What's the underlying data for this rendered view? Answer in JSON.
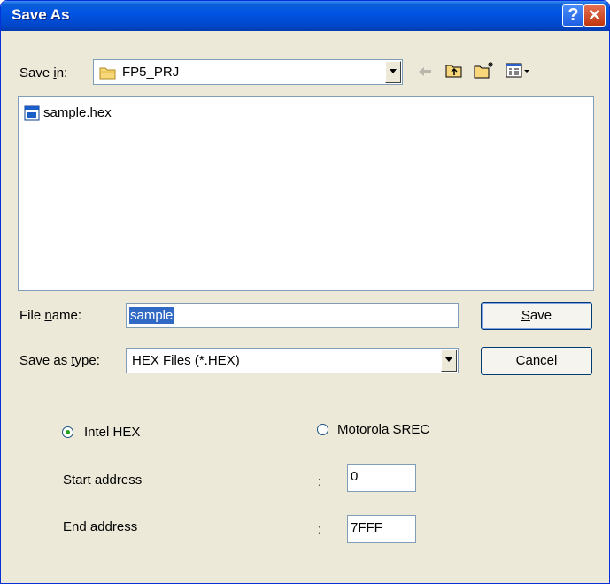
{
  "window": {
    "title": "Save As"
  },
  "title_buttons": {
    "help": "?",
    "close": "✕"
  },
  "toolbar": {
    "save_in_label_pre": "Save ",
    "save_in_label_accel": "i",
    "save_in_label_post": "n:",
    "folder": "FP5_PRJ"
  },
  "files": [
    {
      "name": "sample.hex",
      "icon": "hex-file-icon"
    }
  ],
  "filename": {
    "label_pre": "File ",
    "label_accel": "n",
    "label_post": "ame:",
    "value": "sample"
  },
  "filetype": {
    "label_pre": "Save as ",
    "label_accel": "t",
    "label_post": "ype:",
    "value": "HEX Files (*.HEX)"
  },
  "buttons": {
    "save_accel": "S",
    "save_rest": "ave",
    "cancel": "Cancel"
  },
  "format": {
    "intel_label": "Intel HEX",
    "intel_selected": true,
    "motorola_label": "Motorola SREC",
    "motorola_selected": false
  },
  "start_address": {
    "label": "Start address",
    "colon": ":",
    "value": "0"
  },
  "end_address": {
    "label": "End address",
    "colon": ":",
    "value": "7FFF"
  },
  "colors": {
    "title_bar": "#0054e3",
    "dialog_bg": "#ece9d8",
    "selection": "#316ac5"
  }
}
